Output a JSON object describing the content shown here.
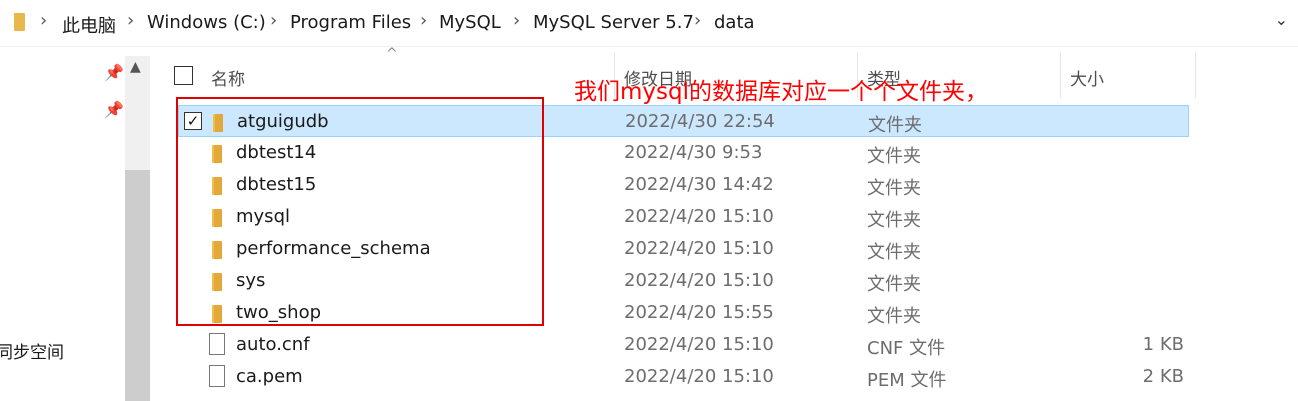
{
  "breadcrumb": {
    "items": [
      "此电脑",
      "Windows (C:)",
      "Program Files",
      "MySQL",
      "MySQL Server 5.7",
      "data"
    ],
    "separator": ">"
  },
  "sidebar": {
    "partial_label": "同步空间"
  },
  "columns": {
    "name": "名称",
    "date": "修改日期",
    "type": "类型",
    "size": "大小"
  },
  "files": [
    {
      "name": "atguigudb",
      "date": "2022/4/30 22:54",
      "type": "文件夹",
      "size": "",
      "icon": "folder-icon",
      "selected": true
    },
    {
      "name": "dbtest14",
      "date": "2022/4/30 9:53",
      "type": "文件夹",
      "size": "",
      "icon": "folder-icon"
    },
    {
      "name": "dbtest15",
      "date": "2022/4/30 14:42",
      "type": "文件夹",
      "size": "",
      "icon": "folder-icon"
    },
    {
      "name": "mysql",
      "date": "2022/4/20 15:10",
      "type": "文件夹",
      "size": "",
      "icon": "folder-icon"
    },
    {
      "name": "performance_schema",
      "date": "2022/4/20 15:10",
      "type": "文件夹",
      "size": "",
      "icon": "folder-icon"
    },
    {
      "name": "sys",
      "date": "2022/4/20 15:10",
      "type": "文件夹",
      "size": "",
      "icon": "folder-icon"
    },
    {
      "name": "two_shop",
      "date": "2022/4/20 15:55",
      "type": "文件夹",
      "size": "",
      "icon": "folder-icon"
    },
    {
      "name": "auto.cnf",
      "date": "2022/4/20 15:10",
      "type": "CNF 文件",
      "size": "1 KB",
      "icon": "file-icon"
    },
    {
      "name": "ca.pem",
      "date": "2022/4/20 15:10",
      "type": "PEM 文件",
      "size": "2 KB",
      "icon": "file-icon"
    }
  ],
  "annotation": "我们mysql的数据库对应一个个文件夹，",
  "colors": {
    "selection": "#cce8ff",
    "annotation": "#ff0000",
    "folder": "#f0c040"
  }
}
